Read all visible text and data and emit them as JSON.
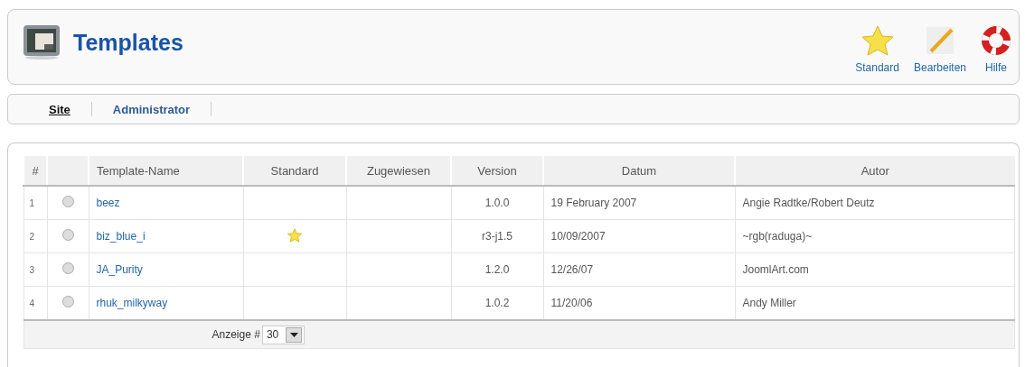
{
  "header": {
    "title": "Templates",
    "toolbar": [
      {
        "kind": "star",
        "label": "Standard"
      },
      {
        "kind": "pencil",
        "label": "Bearbeiten"
      },
      {
        "kind": "lifebuoy",
        "label": "Hilfe"
      }
    ]
  },
  "submenu": [
    {
      "label": "Site",
      "selected": true
    },
    {
      "label": "Administrator",
      "selected": false
    }
  ],
  "table": {
    "columns": [
      "#",
      "Template-Name",
      "Standard",
      "Zugewiesen",
      "Version",
      "Datum",
      "Autor"
    ],
    "rows": [
      {
        "number": "1",
        "selected": false,
        "name": "beez",
        "default": false,
        "version": "1.0.0",
        "date": "19 February 2007",
        "author": "Angie Radtke/Robert Deutz"
      },
      {
        "number": "2",
        "selected": false,
        "name": "biz_blue_i",
        "default": true,
        "version": "r3-j1.5",
        "date": "10/09/2007",
        "author": "~rgb(raduga)~"
      },
      {
        "number": "3",
        "selected": false,
        "name": "JA_Purity",
        "default": false,
        "version": "1.2.0",
        "date": "12/26/07",
        "author": "JoomlArt.com"
      },
      {
        "number": "4",
        "selected": false,
        "name": "rhuk_milkyway",
        "default": false,
        "version": "1.0.2",
        "date": "11/20/06",
        "author": "Andy Miller"
      }
    ],
    "footer": {
      "label": "Anzeige #",
      "page_size": "30"
    }
  }
}
